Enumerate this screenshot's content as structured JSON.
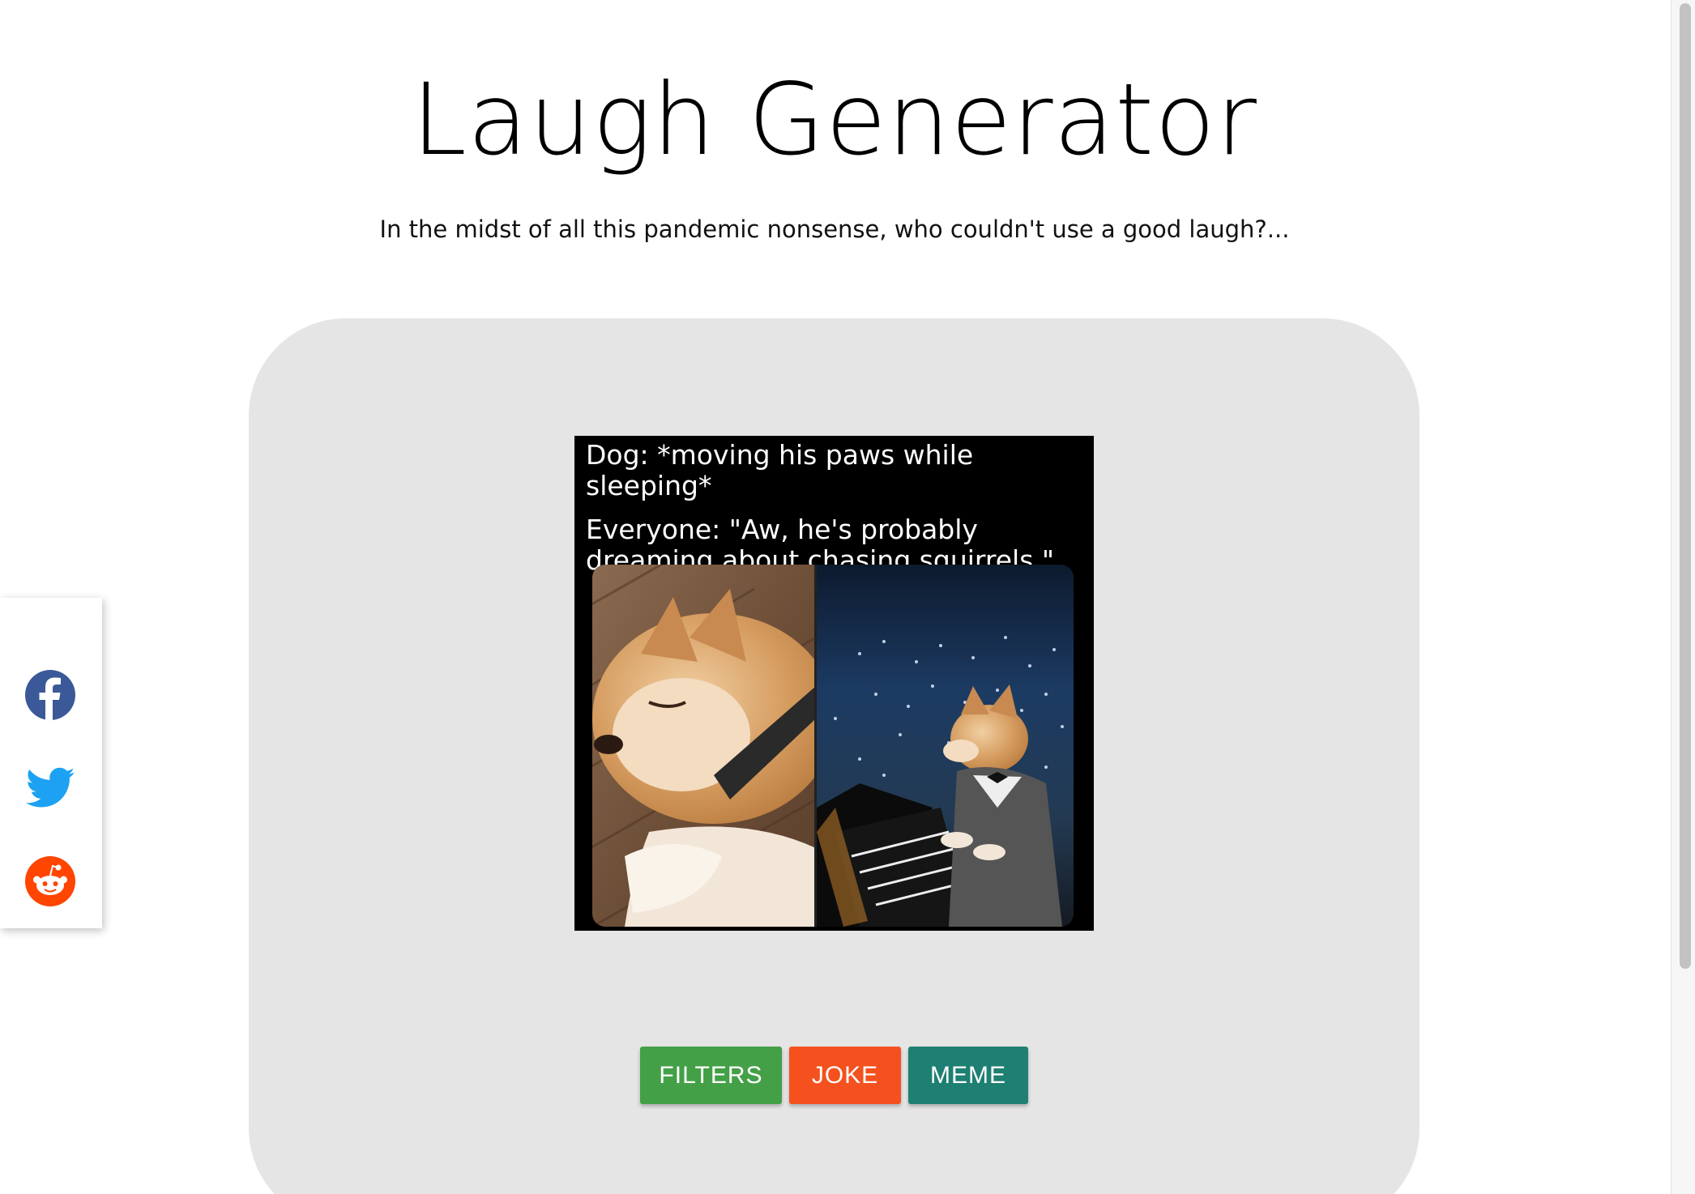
{
  "header": {
    "title": "Laugh Generator",
    "subtitle": "In the midst of all this pandemic nonsense, who couldn't use a good laugh?..."
  },
  "meme": {
    "caption_line1": "Dog: *moving his paws while sleeping*",
    "caption_line2": "Everyone: \"Aw, he's probably dreaming about chasing squirrels.\""
  },
  "buttons": {
    "filters": "FILTERS",
    "joke": "JOKE",
    "meme": "MEME"
  },
  "share": {
    "icons": [
      "facebook-icon",
      "twitter-icon",
      "reddit-icon"
    ]
  },
  "colors": {
    "card_bg": "#e5e5e5",
    "filters_btn": "#43a047",
    "joke_btn": "#f4511e",
    "meme_btn": "#1e7f73",
    "facebook": "#3b5998",
    "twitter": "#1da1f2",
    "reddit": "#ff4500"
  }
}
